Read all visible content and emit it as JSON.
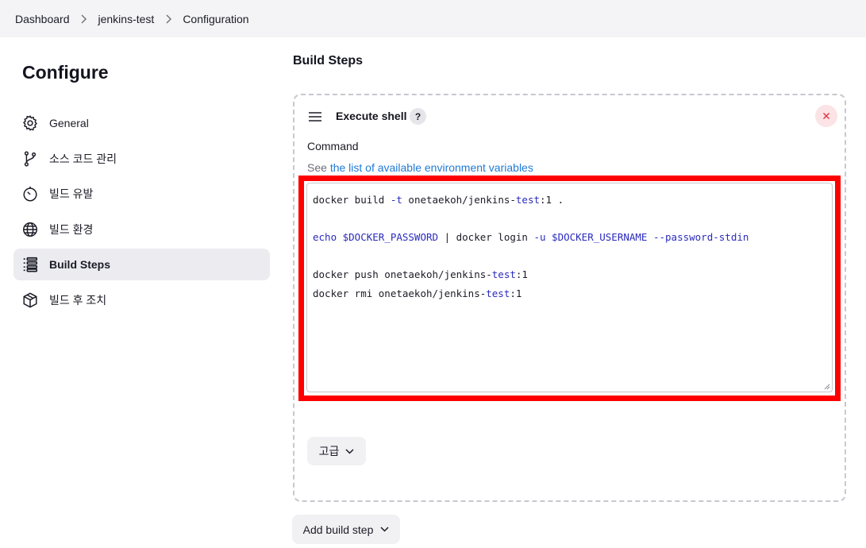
{
  "breadcrumb": {
    "items": [
      "Dashboard",
      "jenkins-test",
      "Configuration"
    ]
  },
  "sidebar": {
    "title": "Configure",
    "items": [
      {
        "label": "General",
        "icon": "gear-icon"
      },
      {
        "label": "소스 코드 관리",
        "icon": "branch-icon"
      },
      {
        "label": "빌드 유발",
        "icon": "timer-icon"
      },
      {
        "label": "빌드 환경",
        "icon": "globe-icon"
      },
      {
        "label": "Build Steps",
        "icon": "list-icon",
        "active": true
      },
      {
        "label": "빌드 후 조치",
        "icon": "package-icon"
      }
    ]
  },
  "main": {
    "section_title": "Build Steps",
    "step": {
      "title": "Execute shell",
      "help": "?",
      "command_label": "Command",
      "see_prefix": "See",
      "see_link": "the list of available environment variables",
      "code_lines": [
        "docker build -t onetaekoh/jenkins-test:1 .",
        "",
        "echo $DOCKER_PASSWORD | docker login -u $DOCKER_USERNAME --password-stdin",
        "",
        "docker push onetaekoh/jenkins-test:1",
        "docker rmi onetaekoh/jenkins-test:1"
      ],
      "advanced_label": "고급"
    },
    "add_step_label": "Add build step"
  },
  "colors": {
    "highlight": "#ff0000",
    "link": "#1f7ad6",
    "close_bg": "#fbe3e6",
    "close_x": "#e0313d",
    "active_bg": "#ebebf0"
  }
}
